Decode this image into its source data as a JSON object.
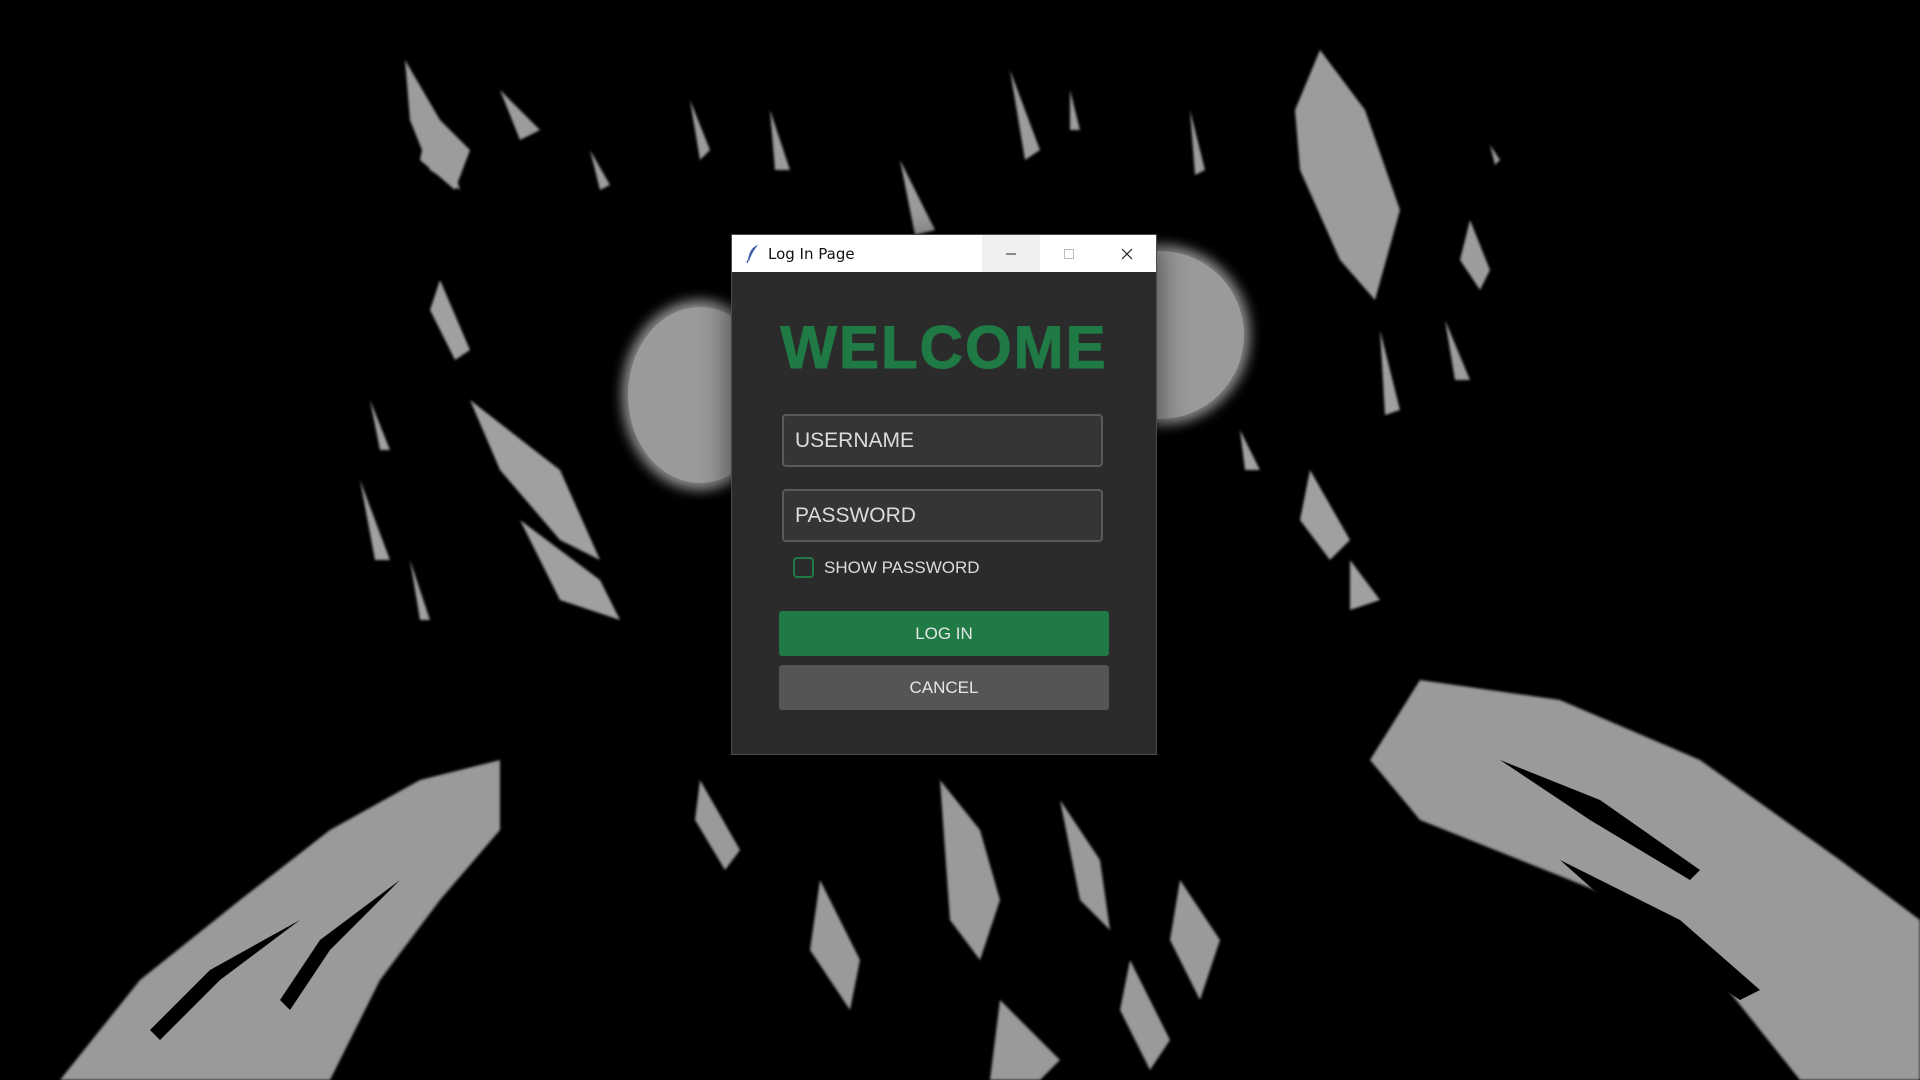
{
  "window": {
    "title": "Log In Page",
    "icon": "feather-icon"
  },
  "heading": "WELCOME",
  "form": {
    "username_placeholder": "USERNAME",
    "password_placeholder": "PASSWORD",
    "show_password_label": "SHOW PASSWORD",
    "show_password_checked": false
  },
  "buttons": {
    "login_label": "LOG IN",
    "cancel_label": "CANCEL"
  },
  "colors": {
    "accent": "#1f7a45",
    "window_bg": "#2b2b2b",
    "cancel_bg": "#555555"
  }
}
